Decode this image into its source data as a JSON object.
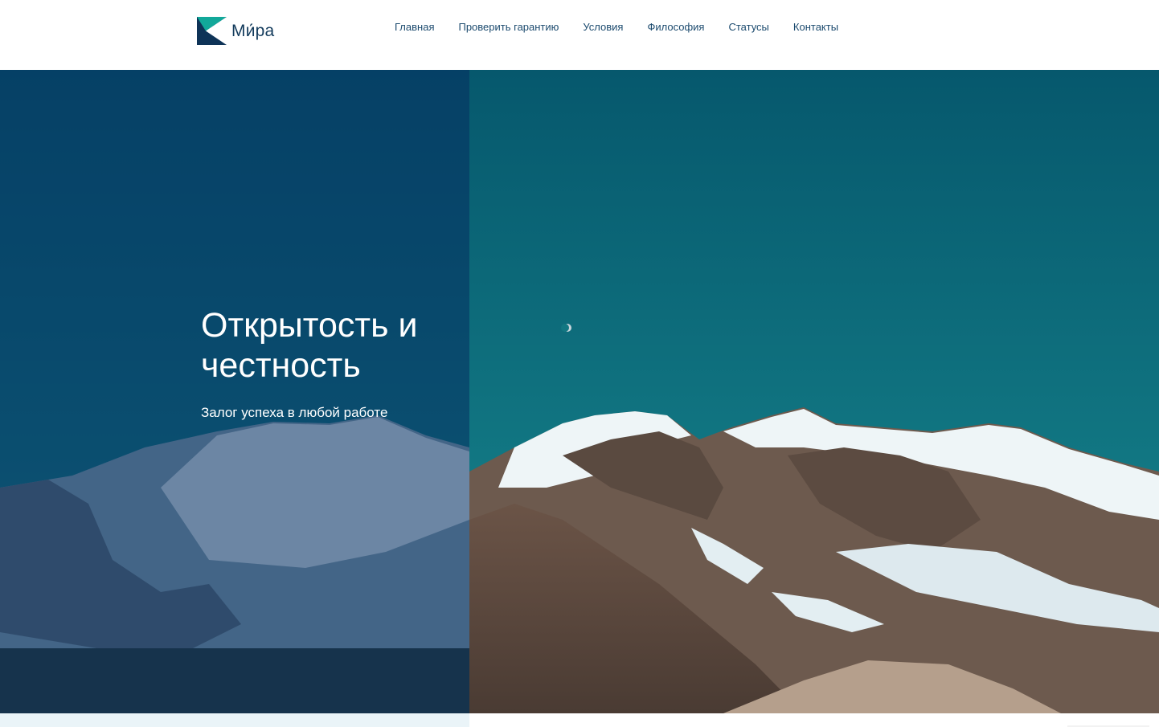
{
  "header": {
    "logo_text": "Ми́ра",
    "logo_icon": "brand-k-mark-icon",
    "nav": [
      {
        "label": "Главная"
      },
      {
        "label": "Проверить гарантию"
      },
      {
        "label": "Условия"
      },
      {
        "label": "Философия"
      },
      {
        "label": "Статусы"
      },
      {
        "label": "Контакты"
      }
    ]
  },
  "hero": {
    "title": "Открытость и честность",
    "subtitle": "Залог успеха в любой работе",
    "background": "mountain-landscape-image"
  },
  "colors": {
    "brand_teal": "#12a89a",
    "brand_navy": "#0e3357",
    "nav_text": "#1b4a6e",
    "overlay": "#052e60",
    "sky": "#0e6a78"
  }
}
